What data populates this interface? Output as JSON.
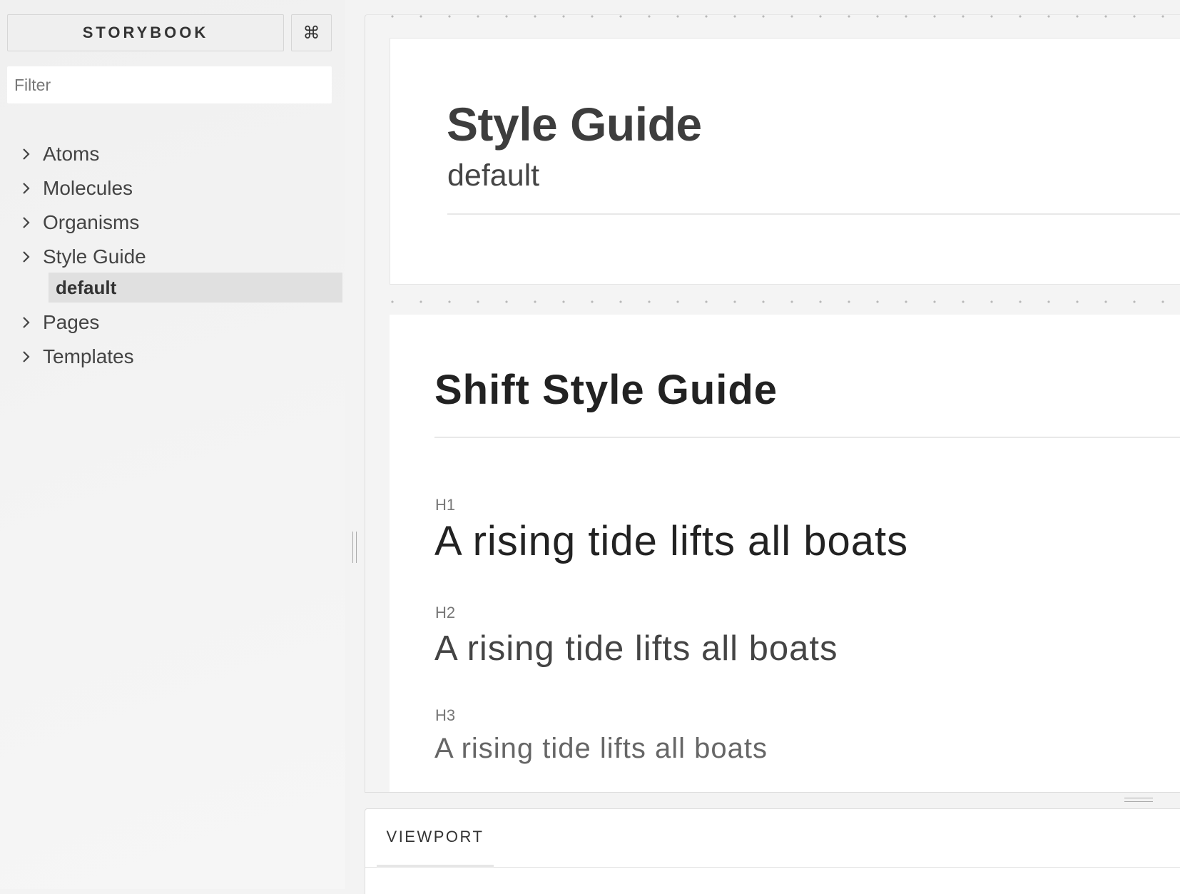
{
  "sidebar": {
    "brand": "STORYBOOK",
    "shortcuts_glyph": "⌘",
    "shortcuts_icon": "command-icon",
    "filter_placeholder": "Filter",
    "filter_value": "",
    "items": [
      {
        "label": "Atoms"
      },
      {
        "label": "Molecules"
      },
      {
        "label": "Organisms"
      },
      {
        "label": "Style Guide",
        "children": [
          {
            "label": "default",
            "selected": true
          }
        ]
      },
      {
        "label": "Pages"
      },
      {
        "label": "Templates"
      }
    ]
  },
  "preview": {
    "story_title": "Style Guide",
    "story_name": "default",
    "page_heading": "Shift Style Guide",
    "type_samples": [
      {
        "label": "H1",
        "text": "A rising tide lifts all boats"
      },
      {
        "label": "H2",
        "text": "A rising tide lifts all boats"
      },
      {
        "label": "H3",
        "text": "A rising tide lifts all boats"
      }
    ]
  },
  "addons": {
    "tabs": [
      {
        "label": "VIEWPORT",
        "active": true
      }
    ]
  },
  "colors": {
    "sidebar_bg": "#f3f3f3",
    "selected_bg": "#e0e0e0",
    "text_primary": "#444444"
  }
}
